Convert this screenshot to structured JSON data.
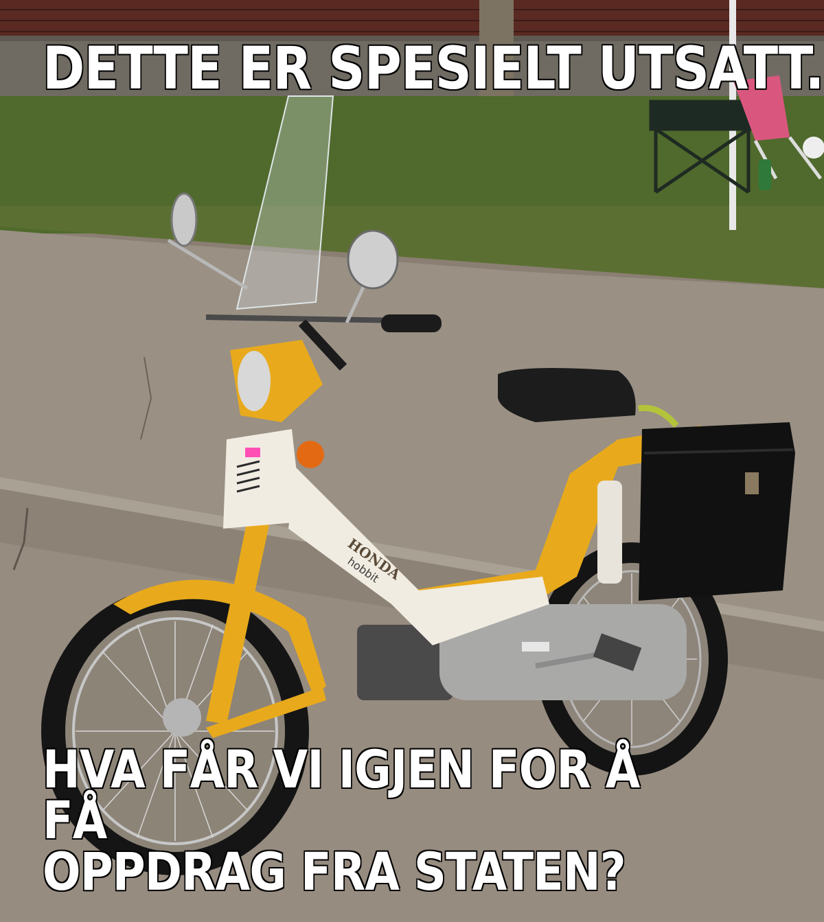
{
  "meme": {
    "top_text": "DETTE ER SPESIELT UTSATT.",
    "bottom_text": "HVA FÅR VI IGJEN FOR Å FÅ\nOPPDRAG FRA STATEN?"
  },
  "photo": {
    "badge_text": "HONDA",
    "model_text": "hobbit",
    "colors": {
      "frame": "#e8aa1c",
      "panel": "#f1ece2",
      "seat": "#1c1c1c",
      "pavement": "#8f857a",
      "grass": "#4f6a2c",
      "brick": "#5a2a22"
    }
  }
}
